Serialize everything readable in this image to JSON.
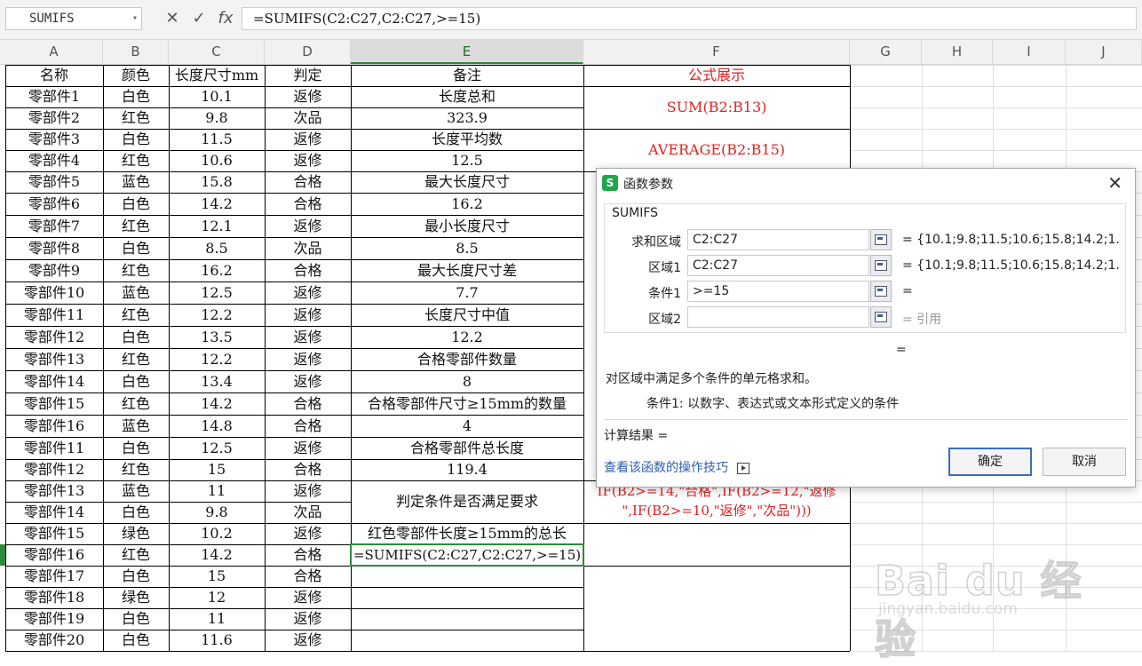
{
  "formula_bar": {
    "name_box": "SUMIFS",
    "cancel_glyph": "✕",
    "confirm_glyph": "✓",
    "fx_label": "fx",
    "formula": "=SUMIFS(C2:C27,C2:C27,>=15)"
  },
  "columns": [
    "A",
    "B",
    "C",
    "D",
    "E",
    "F",
    "G",
    "H",
    "I",
    "J"
  ],
  "selected_column": "E",
  "table": {
    "headers": [
      "名称",
      "颜色",
      "长度尺寸mm",
      "判定"
    ],
    "rows": [
      [
        "零部件1",
        "白色",
        "10.1",
        "返修"
      ],
      [
        "零部件2",
        "红色",
        "9.8",
        "次品"
      ],
      [
        "零部件3",
        "白色",
        "11.5",
        "返修"
      ],
      [
        "零部件4",
        "红色",
        "10.6",
        "返修"
      ],
      [
        "零部件5",
        "蓝色",
        "15.8",
        "合格"
      ],
      [
        "零部件6",
        "白色",
        "14.2",
        "合格"
      ],
      [
        "零部件7",
        "红色",
        "12.1",
        "返修"
      ],
      [
        "零部件8",
        "白色",
        "8.5",
        "次品"
      ],
      [
        "零部件9",
        "红色",
        "16.2",
        "合格"
      ],
      [
        "零部件10",
        "蓝色",
        "12.5",
        "返修"
      ],
      [
        "零部件11",
        "红色",
        "12.2",
        "返修"
      ],
      [
        "零部件12",
        "白色",
        "13.5",
        "返修"
      ],
      [
        "零部件13",
        "红色",
        "12.2",
        "返修"
      ],
      [
        "零部件14",
        "白色",
        "13.4",
        "返修"
      ],
      [
        "零部件15",
        "红色",
        "14.2",
        "合格"
      ],
      [
        "零部件16",
        "蓝色",
        "14.8",
        "合格"
      ],
      [
        "零部件11",
        "白色",
        "12.5",
        "返修"
      ],
      [
        "零部件12",
        "红色",
        "15",
        "合格"
      ],
      [
        "零部件13",
        "蓝色",
        "11",
        "返修"
      ],
      [
        "零部件14",
        "白色",
        "9.8",
        "次品"
      ],
      [
        "零部件15",
        "绿色",
        "10.2",
        "返修"
      ],
      [
        "零部件16",
        "红色",
        "14.2",
        "合格"
      ],
      [
        "零部件17",
        "白色",
        "15",
        "合格"
      ],
      [
        "零部件18",
        "绿色",
        "12",
        "返修"
      ],
      [
        "零部件19",
        "白色",
        "11",
        "返修"
      ],
      [
        "零部件20",
        "白色",
        "11.6",
        "返修"
      ]
    ],
    "notes_header": "备注",
    "notes": [
      "长度总和",
      "323.9",
      "长度平均数",
      "12.5",
      "最大长度尺寸",
      "16.2",
      "最小长度尺寸",
      "8.5",
      "最大长度尺寸差",
      "7.7",
      "长度尺寸中值",
      "12.2",
      "合格零部件数量",
      "8",
      "合格零部件尺寸≥15mm的数量",
      "4",
      "合格零部件总长度",
      "119.4",
      "判定条件是否满足要求",
      "红色零部件长度≥15mm的总长",
      "=SUMIFS(C2:C27,C2:C27,>=15)"
    ],
    "formula_header": "公式展示",
    "formulas": {
      "sum": "SUM(B2:B13)",
      "average": "AVERAGE(B2:B15)",
      "if_line1": "IF(B2>=14,\"合格\",IF(B2>=12,\"返修",
      "if_line2": "\",IF(B2>=10,\"返修\",\"次品\")))"
    }
  },
  "dialog": {
    "title": "函数参数",
    "logo_letter": "S",
    "close_glyph": "✕",
    "function_name": "SUMIFS",
    "args": [
      {
        "label": "求和区域",
        "value": "C2:C27",
        "result": "= {10.1;9.8;11.5;10.6;15.8;14.2;1..."
      },
      {
        "label": "区域1",
        "value": "C2:C27",
        "result": "= {10.1;9.8;11.5;10.6;15.8;14.2;1..."
      },
      {
        "label": "条件1",
        "value": ">=15",
        "result": "="
      },
      {
        "label": "区域2",
        "value": "",
        "result": "= 引用"
      }
    ],
    "overall_eq": "=",
    "description": "对区域中满足多个条件的单元格求和。",
    "arg_help": "条件1:  以数字、表达式或文本形式定义的条件",
    "result_label": "计算结果 =",
    "tips_link": "查看该函数的操作技巧",
    "ok_label": "确定",
    "cancel_label": "取消"
  },
  "watermark": {
    "text": "Bai du 经验",
    "url": "jingyan.baidu.com"
  },
  "colors": {
    "red_text": "#e02020",
    "accent_green": "#2e8b3d",
    "link_blue": "#2c5fb0"
  }
}
